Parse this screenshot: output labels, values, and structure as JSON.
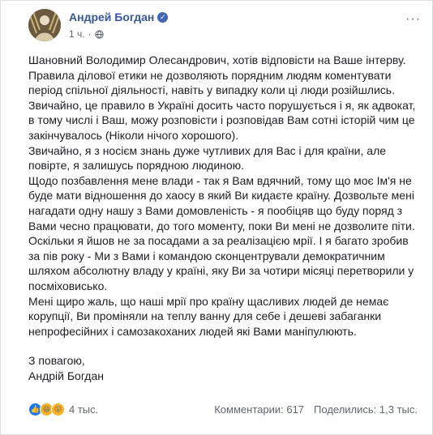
{
  "post": {
    "author": "Андрей Богдан",
    "timestamp": "1 ч.",
    "more_label": "···",
    "paragraphs": [
      "Шановний Володимир Олесандрович, хотів відповісти на Ваше інтерву.",
      "Правила ділової етики не дозволяють порядним людям коментувати період спільної діяльності, навіть у випадку коли ці люди розійшлись.",
      "Звичайно, це правило в Україні досить часто порушується і я, як адвокат, в тому числі і Ваш, можу розповісти і розповідав Вам сотні історій чим це закінчувалось (Ніколи нічого хорошого).",
      "Звичайно, я з носієм знань дуже чутливих для Вас і для країни, але повірте, я залишусь порядною людиною.",
      "Щодо позбавлення мене влади - так я Вам вдячний, тому що моє Ім'я не буде мати відношення до хаосу в який Ви кидаєте країну. Дозвольте мені нагадати одну нашу з Вами домовленість - я пообіцяв що буду поряд з Вами чесно працювати, до того моменту, поки Ви мені не дозволите піти. Оскільки я йшов не за посадами а за реалізацією мрії. І я багато зробив за пів року - Ми з Вами і командою сконцентрували демократичним шляхом абсолютну владу у країні, яку Ви за чотири місяці перетворили у посміховисько.",
      "Мені щиро жаль, що наші мрії про країну щасливих людей де немає корупції, Ви проміняли на теплу ванну для себе і дешеві забаганки непрофесійних і самозакоханих людей які Вами маніпулюють."
    ],
    "closing": "З повагою,",
    "signature": "Андрій Богдан"
  },
  "footer": {
    "reactions_count": "4 тыс.",
    "comments": "Комментарии: 617",
    "shares": "Поделились: 1,3 тыс."
  },
  "icons": {
    "verified": "verified-badge-icon",
    "globe": "globe-icon",
    "like": "like-reaction-icon",
    "haha": "haha-reaction-icon",
    "wow": "wow-reaction-icon"
  },
  "colors": {
    "author_link": "#385898",
    "like_blue": "#1877f2",
    "emoji_yellow": "#f7b125"
  }
}
